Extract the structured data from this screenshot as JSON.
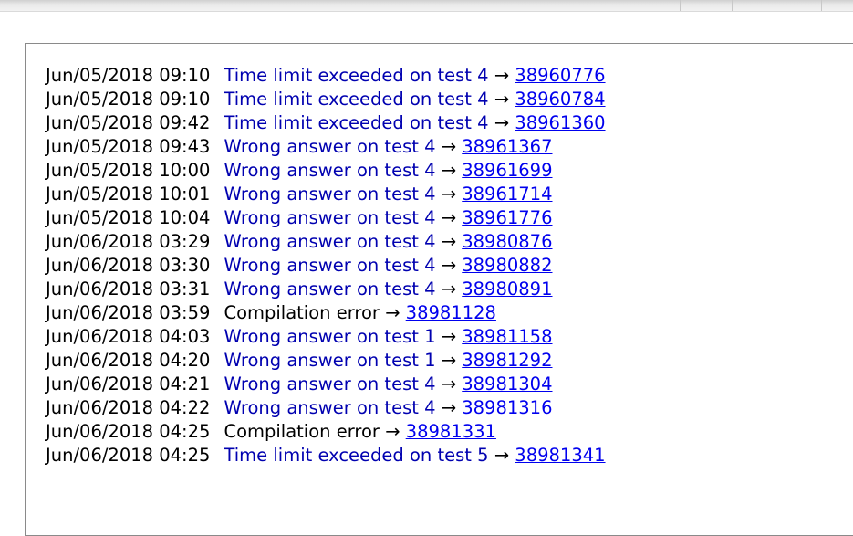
{
  "colors": {
    "verdict_fail": "#0000b0",
    "verdict_compile": "#000000",
    "link": "#0000ee"
  },
  "submissions": [
    {
      "time": "Jun/05/2018 09:10",
      "verdict": "Time limit exceeded on test 4",
      "arrow": "→",
      "id": "38960776",
      "kind": "blue"
    },
    {
      "time": "Jun/05/2018 09:10",
      "verdict": "Time limit exceeded on test 4",
      "arrow": "→",
      "id": "38960784",
      "kind": "blue"
    },
    {
      "time": "Jun/05/2018 09:42",
      "verdict": "Time limit exceeded on test 4",
      "arrow": "→",
      "id": "38961360",
      "kind": "blue"
    },
    {
      "time": "Jun/05/2018 09:43",
      "verdict": "Wrong answer on test 4",
      "arrow": "→",
      "id": "38961367",
      "kind": "blue"
    },
    {
      "time": "Jun/05/2018 10:00",
      "verdict": "Wrong answer on test 4",
      "arrow": "→",
      "id": "38961699",
      "kind": "blue"
    },
    {
      "time": "Jun/05/2018 10:01",
      "verdict": "Wrong answer on test 4",
      "arrow": "→",
      "id": "38961714",
      "kind": "blue"
    },
    {
      "time": "Jun/05/2018 10:04",
      "verdict": "Wrong answer on test 4",
      "arrow": "→",
      "id": "38961776",
      "kind": "blue"
    },
    {
      "time": "Jun/06/2018 03:29",
      "verdict": "Wrong answer on test 4",
      "arrow": "→",
      "id": "38980876",
      "kind": "blue"
    },
    {
      "time": "Jun/06/2018 03:30",
      "verdict": "Wrong answer on test 4",
      "arrow": "→",
      "id": "38980882",
      "kind": "blue"
    },
    {
      "time": "Jun/06/2018 03:31",
      "verdict": "Wrong answer on test 4",
      "arrow": "→",
      "id": "38980891",
      "kind": "blue"
    },
    {
      "time": "Jun/06/2018 03:59",
      "verdict": "Compilation error",
      "arrow": "→",
      "id": "38981128",
      "kind": "black"
    },
    {
      "time": "Jun/06/2018 04:03",
      "verdict": "Wrong answer on test 1",
      "arrow": "→",
      "id": "38981158",
      "kind": "blue"
    },
    {
      "time": "Jun/06/2018 04:20",
      "verdict": "Wrong answer on test 1",
      "arrow": "→",
      "id": "38981292",
      "kind": "blue"
    },
    {
      "time": "Jun/06/2018 04:21",
      "verdict": "Wrong answer on test 4",
      "arrow": "→",
      "id": "38981304",
      "kind": "blue"
    },
    {
      "time": "Jun/06/2018 04:22",
      "verdict": "Wrong answer on test 4",
      "arrow": "→",
      "id": "38981316",
      "kind": "blue"
    },
    {
      "time": "Jun/06/2018 04:25",
      "verdict": "Compilation error",
      "arrow": "→",
      "id": "38981331",
      "kind": "black"
    },
    {
      "time": "Jun/06/2018 04:25",
      "verdict": "Time limit exceeded on test 5",
      "arrow": "→",
      "id": "38981341",
      "kind": "blue"
    }
  ]
}
